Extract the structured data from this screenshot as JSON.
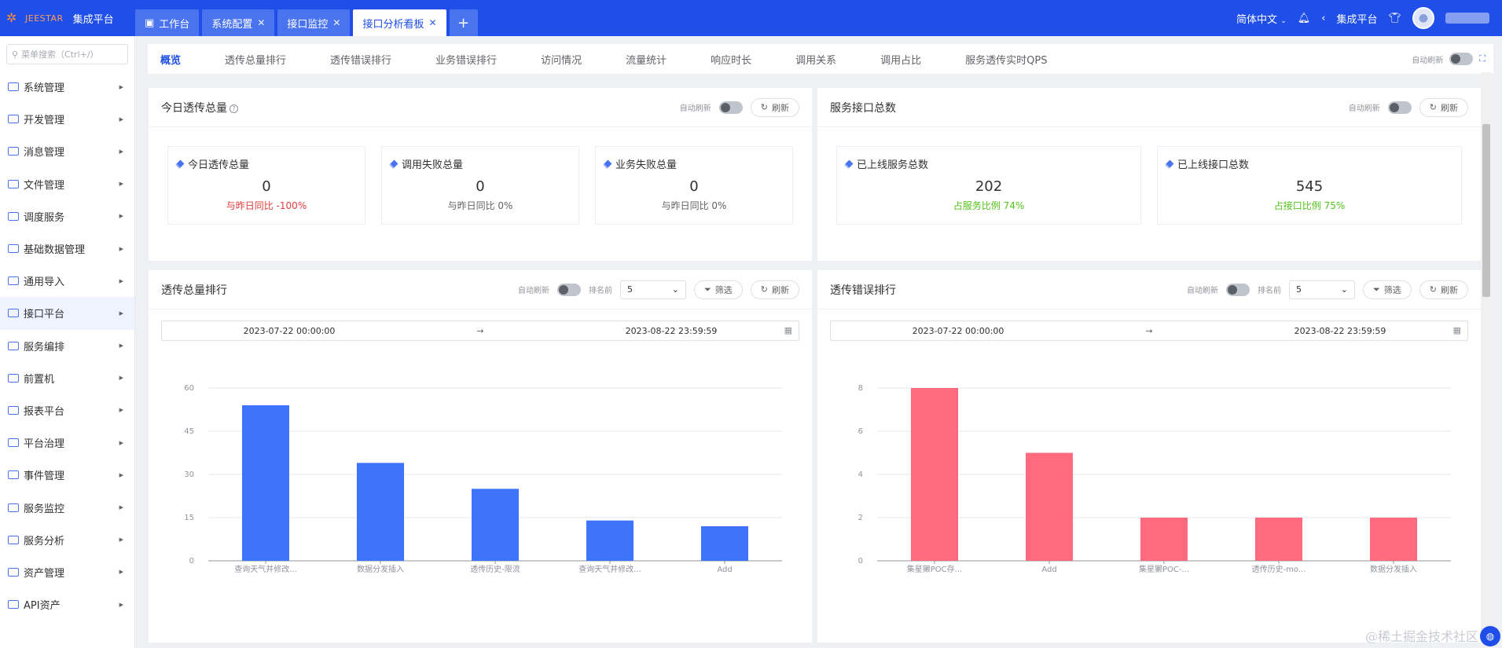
{
  "app": {
    "brand_word": "JEESTAR",
    "brand_name": "集成平台"
  },
  "tabs": [
    {
      "label": "工作台",
      "closable": false,
      "active": false
    },
    {
      "label": "系统配置",
      "closable": true,
      "active": false
    },
    {
      "label": "接口监控",
      "closable": true,
      "active": false
    },
    {
      "label": "接口分析看板",
      "closable": true,
      "active": true
    }
  ],
  "topbar": {
    "language": "简体中文",
    "platform": "集成平台"
  },
  "sidebar": {
    "search_placeholder": "菜单搜索（Ctrl+/）",
    "items": [
      "系统管理",
      "开发管理",
      "消息管理",
      "文件管理",
      "调度服务",
      "基础数据管理",
      "通用导入",
      "接口平台",
      "服务编排",
      "前置机",
      "报表平台",
      "平台治理",
      "事件管理",
      "服务监控",
      "服务分析",
      "资产管理",
      "API资产"
    ],
    "active_index": 7
  },
  "subnav": {
    "items": [
      "概览",
      "透传总量排行",
      "透传错误排行",
      "业务错误排行",
      "访问情况",
      "流量统计",
      "响应时长",
      "调用关系",
      "调用占比",
      "服务透传实时QPS"
    ],
    "active_index": 0,
    "auto_refresh": "自动刷新"
  },
  "common": {
    "auto_refresh": "自动刷新",
    "refresh": "刷新",
    "rank_top": "排名前",
    "filter": "筛选"
  },
  "today_panel": {
    "title": "今日透传总量",
    "stats": [
      {
        "label": "今日透传总量",
        "value": "0",
        "sub": "与昨日同比 -100%",
        "tone": "red"
      },
      {
        "label": "调用失败总量",
        "value": "0",
        "sub": "与昨日同比 0%",
        "tone": "normal"
      },
      {
        "label": "业务失败总量",
        "value": "0",
        "sub": "与昨日同比 0%",
        "tone": "normal"
      }
    ]
  },
  "service_panel": {
    "title": "服务接口总数",
    "stats": [
      {
        "label": "已上线服务总数",
        "value": "202",
        "sub": "占服务比例 74%",
        "tone": "green"
      },
      {
        "label": "已上线接口总数",
        "value": "545",
        "sub": "占接口比例 75%",
        "tone": "green"
      }
    ]
  },
  "rank_panel": {
    "title": "透传总量排行",
    "rank_value": "5",
    "date_start": "2023-07-22 00:00:00",
    "date_sep": "→",
    "date_end": "2023-08-22 23:59:59"
  },
  "error_panel": {
    "title": "透传错误排行",
    "rank_value": "5",
    "date_start": "2023-07-22 00:00:00",
    "date_sep": "→",
    "date_end": "2023-08-22 23:59:59"
  },
  "colors": {
    "accent": "#1f4fe8",
    "bar_total": "#3d74fb",
    "bar_error": "#ff6b7e"
  },
  "watermark": "@稀土掘金技术社区",
  "chart_data": [
    {
      "type": "bar",
      "title": "",
      "categories": [
        "查询天气并修改...",
        "数据分发插入",
        "透传历史-限流",
        "查询天气并修改...",
        "Add"
      ],
      "values": [
        54,
        34,
        25,
        14,
        12
      ],
      "ylim": [
        0,
        60
      ],
      "yticks": [
        0,
        15,
        30,
        45,
        60
      ],
      "grid": true,
      "color": "#3d74fb"
    },
    {
      "type": "bar",
      "title": "",
      "categories": [
        "集星獭POC存...",
        "Add",
        "集星獭POC-...",
        "透传历史-mo...",
        "数据分发插入"
      ],
      "values": [
        8,
        5,
        2,
        2,
        2
      ],
      "ylim": [
        0,
        8
      ],
      "yticks": [
        0,
        2,
        4,
        6,
        8
      ],
      "grid": true,
      "color": "#ff6b7e"
    }
  ]
}
